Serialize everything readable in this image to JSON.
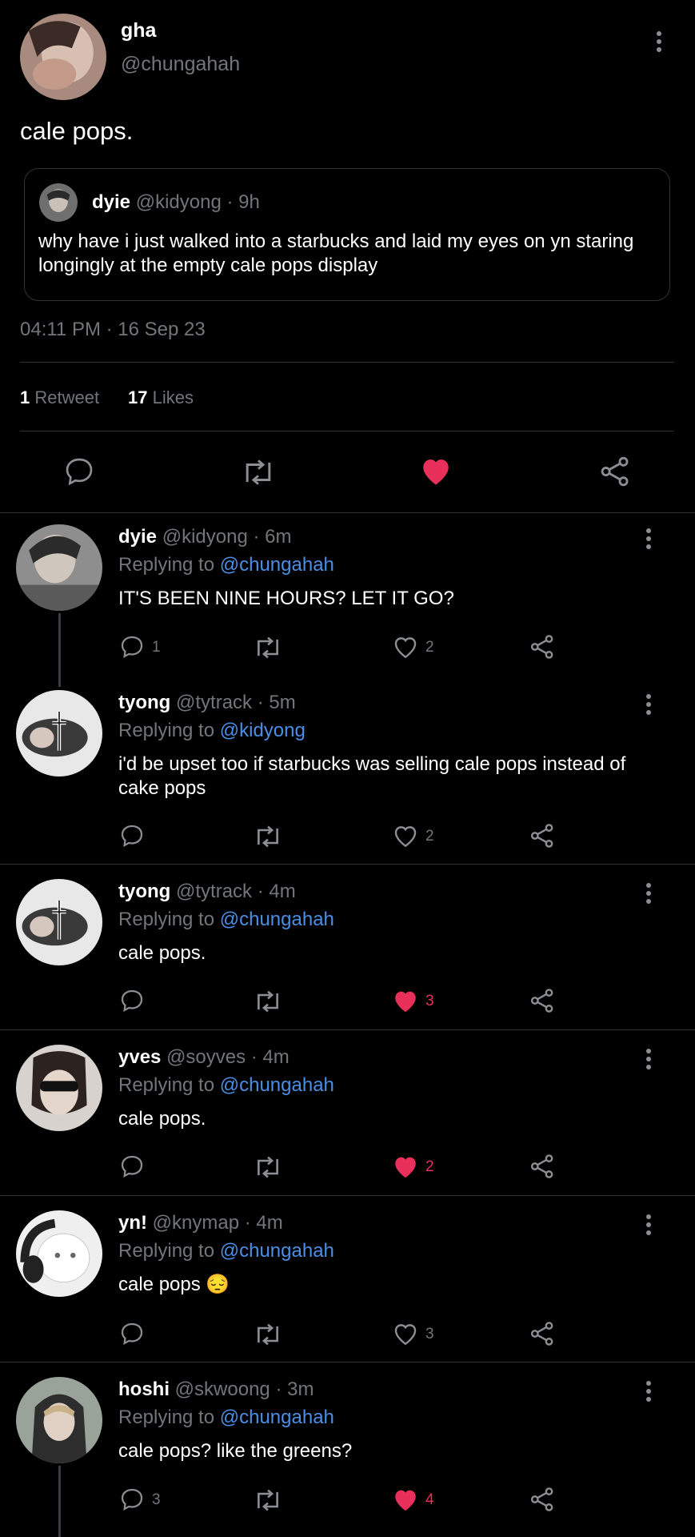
{
  "tweet": {
    "name": "gha",
    "handle": "@chungahah",
    "text": "cale pops.",
    "quote": {
      "name": "dyie",
      "handle": "@kidyong",
      "time": "· 9h",
      "text": "why have i just walked into a starbucks and laid my eyes on yn staring longingly at the empty cale pops display"
    },
    "timestamp": "04:11 PM · 16 Sep 23",
    "retweet_count": "1",
    "retweet_label": "Retweet",
    "like_count": "17",
    "like_label": "Likes"
  },
  "replies": [
    {
      "name": "dyie",
      "handle": "@kidyong",
      "time": "· 6m",
      "replying_label": "Replying to",
      "replying_to": "@chungahah",
      "text": "IT'S BEEN NINE HOURS? LET IT GO?",
      "reply_count": "1",
      "like_count": "2",
      "liked": false
    },
    {
      "name": "tyong",
      "handle": "@tytrack",
      "time": "· 5m",
      "replying_label": "Replying to",
      "replying_to": "@kidyong",
      "text": "i'd be upset too if starbucks was selling cale pops instead of cake pops",
      "reply_count": "",
      "like_count": "2",
      "liked": false
    },
    {
      "name": "tyong",
      "handle": "@tytrack",
      "time": "· 4m",
      "replying_label": "Replying to",
      "replying_to": "@chungahah",
      "text": "cale pops.",
      "reply_count": "",
      "like_count": "3",
      "liked": true
    },
    {
      "name": "yves",
      "handle": "@soyves",
      "time": "· 4m",
      "replying_label": "Replying to",
      "replying_to": "@chungahah",
      "text": "cale pops.",
      "reply_count": "",
      "like_count": "2",
      "liked": true
    },
    {
      "name": "yn!",
      "handle": "@knymap",
      "time": "· 4m",
      "replying_label": "Replying to",
      "replying_to": "@chungahah",
      "text": "cale pops 😔",
      "reply_count": "",
      "like_count": "3",
      "liked": false
    },
    {
      "name": "hoshi",
      "handle": "@skwoong",
      "time": "· 3m",
      "replying_label": "Replying to",
      "replying_to": "@chungahah",
      "text": "cale pops? like the greens?",
      "reply_count": "3",
      "like_count": "4",
      "liked": true
    }
  ],
  "colors": {
    "like": "#e8305a",
    "link": "#4a8ee6",
    "muted": "#71767b"
  }
}
